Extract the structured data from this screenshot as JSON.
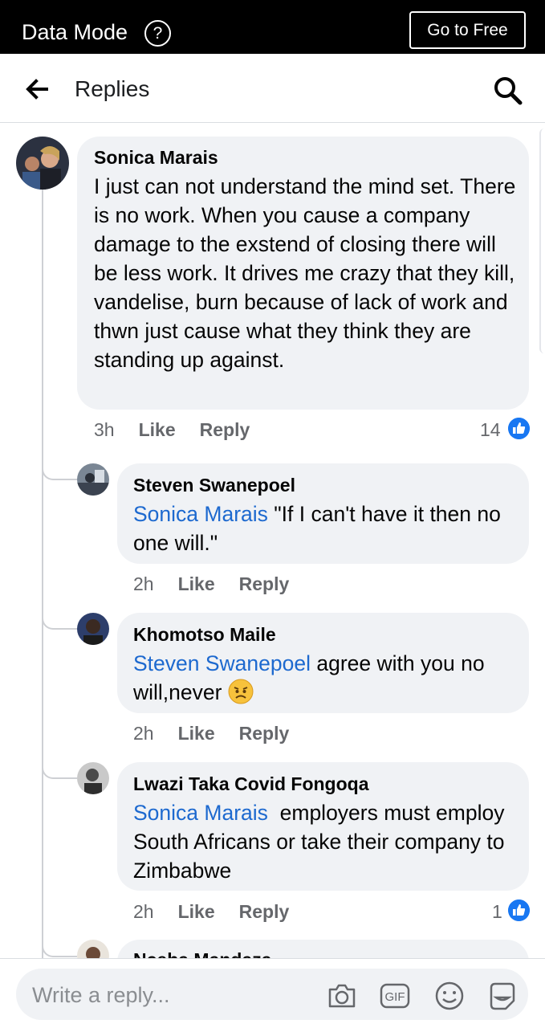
{
  "topbar": {
    "title": "Data Mode",
    "help_glyph": "?",
    "free_label": "Go to Free"
  },
  "header": {
    "title": "Replies"
  },
  "comment": {
    "author": "Sonica Marais",
    "text": "I just can not understand the mind set. There is no work. When you cause a company damage to the exstend of closing there will be less work. It drives me crazy that they kill, vandelise, burn because of lack of work and thwn just cause what they think they are standing up against.",
    "time": "3h",
    "like": "Like",
    "reply": "Reply",
    "reactions": "14"
  },
  "replies": [
    {
      "author": "Steven Swanepoel",
      "mention": "Sonica Marais",
      "text": " \"If I can't have it then no one will.\"",
      "time": "2h",
      "like": "Like",
      "reply": "Reply"
    },
    {
      "author": "Khomotso Maile",
      "mention": "Steven Swanepoel",
      "text": " agree with you no will,never",
      "emoji": "angry-face",
      "time": "2h",
      "like": "Like",
      "reply": "Reply"
    },
    {
      "author": "Lwazi Taka Covid Fongoqa",
      "mention": "Sonica Marais",
      "text": "  employers must employ South Africans or take their company to Zimbabwe",
      "time": "2h",
      "like": "Like",
      "reply": "Reply",
      "reactions": "1"
    },
    {
      "author": "Nceba Mandaza"
    }
  ],
  "composer": {
    "placeholder": "Write a reply..."
  },
  "colors": {
    "mention": "#1d69cf",
    "bubble": "#f0f2f5",
    "meta": "#65676b",
    "like_blue": "#1877f2"
  },
  "icons": [
    "back-arrow-icon",
    "search-icon",
    "help-icon",
    "camera-icon",
    "gif-icon",
    "emoji-icon",
    "sticker-icon",
    "like-reaction-icon",
    "angry-face-icon"
  ]
}
